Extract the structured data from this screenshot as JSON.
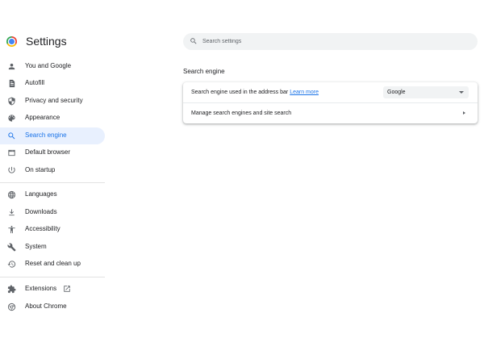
{
  "app": {
    "title": "Settings"
  },
  "search": {
    "placeholder": "Search settings"
  },
  "sidebar": {
    "items": [
      {
        "label": "You and Google",
        "icon": "person-icon",
        "active": false
      },
      {
        "label": "Autofill",
        "icon": "autofill-icon",
        "active": false
      },
      {
        "label": "Privacy and security",
        "icon": "shield-icon",
        "active": false
      },
      {
        "label": "Appearance",
        "icon": "palette-icon",
        "active": false
      },
      {
        "label": "Search engine",
        "icon": "search-icon",
        "active": true
      },
      {
        "label": "Default browser",
        "icon": "browser-icon",
        "active": false
      },
      {
        "label": "On startup",
        "icon": "power-icon",
        "active": false
      },
      {
        "label": "Languages",
        "icon": "globe-icon",
        "active": false
      },
      {
        "label": "Downloads",
        "icon": "download-icon",
        "active": false
      },
      {
        "label": "Accessibility",
        "icon": "accessibility-icon",
        "active": false
      },
      {
        "label": "System",
        "icon": "wrench-icon",
        "active": false
      },
      {
        "label": "Reset and clean up",
        "icon": "reset-icon",
        "active": false
      },
      {
        "label": "Extensions",
        "icon": "puzzle-icon",
        "active": false
      },
      {
        "label": "About Chrome",
        "icon": "chrome-icon",
        "active": false
      }
    ]
  },
  "main": {
    "section_title": "Search engine",
    "row1": {
      "label": "Search engine used in the address bar",
      "link": "Learn more",
      "selected": "Google"
    },
    "row2": {
      "label": "Manage search engines and site search"
    }
  },
  "colors": {
    "accent": "#1a73e8",
    "active_bg": "#e8f0fe",
    "icon": "#5f6368"
  }
}
